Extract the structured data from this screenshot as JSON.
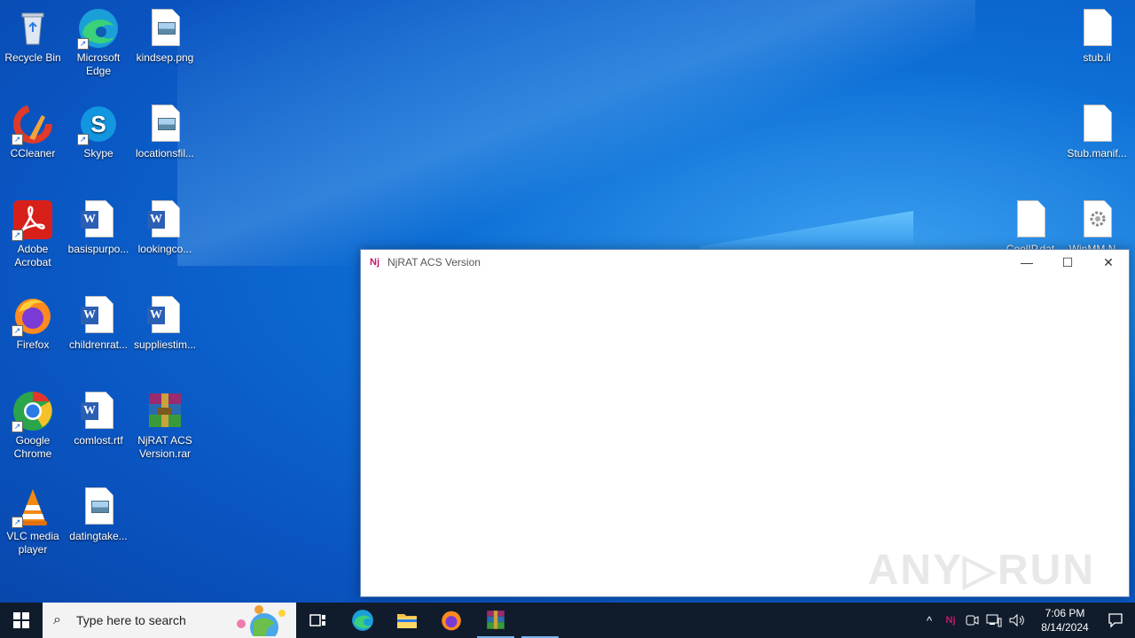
{
  "desktop": {
    "icons": [
      {
        "label": "Recycle Bin",
        "icon": "recycle-bin-icon"
      },
      {
        "label": "Microsoft Edge",
        "icon": "edge-icon"
      },
      {
        "label": "kindsep.png",
        "icon": "image-file-icon"
      },
      {
        "label": "CCleaner",
        "icon": "ccleaner-icon"
      },
      {
        "label": "Skype",
        "icon": "skype-icon"
      },
      {
        "label": "locationsfil...",
        "icon": "image-file-icon"
      },
      {
        "label": "Adobe Acrobat",
        "icon": "acrobat-icon"
      },
      {
        "label": "basispurpo...",
        "icon": "word-doc-icon"
      },
      {
        "label": "lookingco...",
        "icon": "word-doc-icon"
      },
      {
        "label": "Firefox",
        "icon": "firefox-icon"
      },
      {
        "label": "childrenrat...",
        "icon": "word-doc-icon"
      },
      {
        "label": "suppliestim...",
        "icon": "word-doc-icon"
      },
      {
        "label": "Google Chrome",
        "icon": "chrome-icon"
      },
      {
        "label": "comlost.rtf",
        "icon": "word-doc-icon"
      },
      {
        "label": "NjRAT ACS Version.rar",
        "icon": "winrar-icon"
      },
      {
        "label": "VLC media player",
        "icon": "vlc-icon"
      },
      {
        "label": "datingtake...",
        "icon": "image-file-icon"
      },
      {
        "label": "stub.il",
        "icon": "file-icon"
      },
      {
        "label": "Stub.manif...",
        "icon": "file-icon"
      },
      {
        "label": "CoolIP.dat",
        "icon": "file-icon"
      },
      {
        "label": "WinMM.N...",
        "icon": "settings-file-icon"
      }
    ]
  },
  "window": {
    "title": "NjRAT ACS Version",
    "app_icon": "Nj",
    "minimize_glyph": "—",
    "maximize_glyph": "☐",
    "close_glyph": "✕",
    "watermark": "ANY▷RUN"
  },
  "taskbar": {
    "search_placeholder": "Type here to search",
    "clock_time": "7:06 PM",
    "clock_date": "8/14/2024",
    "tray_chevron": "^",
    "tray_nj": "Nj"
  }
}
